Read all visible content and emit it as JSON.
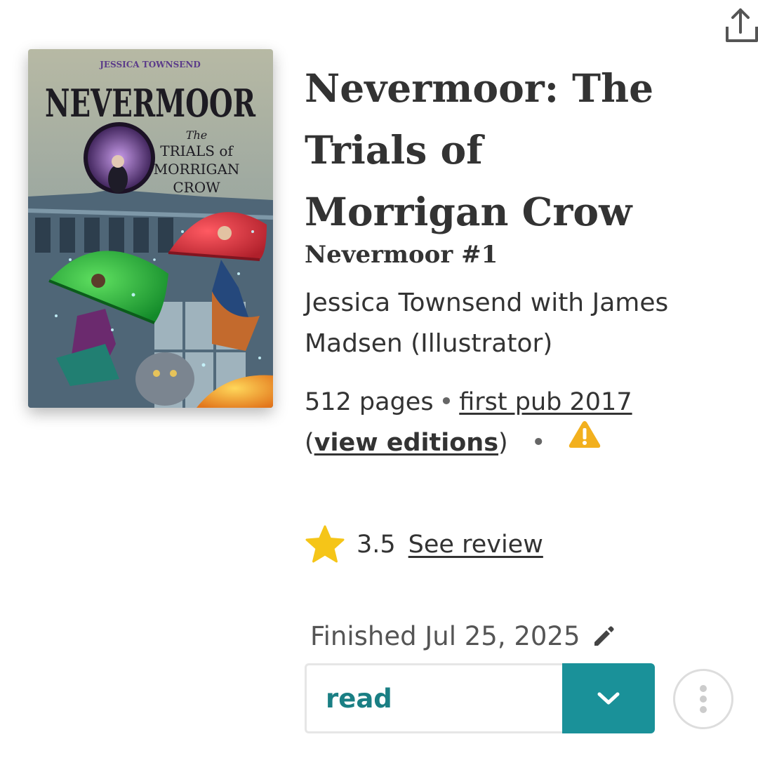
{
  "book": {
    "title": "Nevermoor: The Trials of Morrigan Crow",
    "series": "Nevermoor #1",
    "contributors": "Jessica Townsend with James Madsen (Illustrator)",
    "pages": "512 pages",
    "first_pub": "first pub 2017",
    "view_editions": "view editions",
    "cover": {
      "author": "JESSICA TOWNSEND",
      "title": "NEVERMOOR",
      "subtitle_the": "The",
      "subtitle_line1": "TRIALS of",
      "subtitle_line2": "MORRIGAN",
      "subtitle_line3": "CROW"
    }
  },
  "rating": {
    "value": "3.5",
    "review_link": "See review"
  },
  "shelf": {
    "finished_label": "Finished Jul 25, 2025",
    "status": "read"
  },
  "colors": {
    "teal": "#1a9199",
    "status_text": "#1a7f84",
    "star": "#f5c518",
    "warning": "#f2b01e"
  },
  "icons": {
    "share": "share-icon",
    "warning": "warning-icon",
    "star": "star-icon",
    "edit": "pencil-icon",
    "dropdown": "chevron-down-icon",
    "more": "more-vertical-icon"
  }
}
